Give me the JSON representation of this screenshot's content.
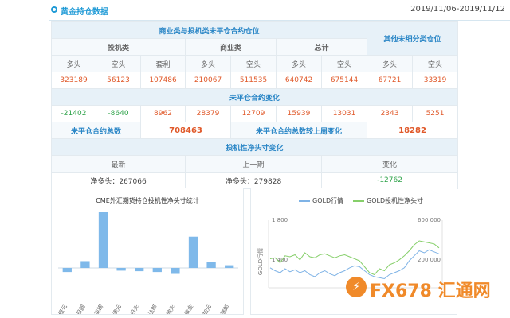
{
  "header": {
    "title": "黄金持仓数据",
    "date_range": "2019/11/06-2019/11/12"
  },
  "table": {
    "sec1_title": "商业类与投机类未平仓合约仓位",
    "sec1_other": "其他未细分类仓位",
    "groups": [
      "投机类",
      "商业类",
      "总计"
    ],
    "cols": [
      "多头",
      "空头",
      "套利",
      "多头",
      "空头",
      "多头",
      "空头",
      "多头",
      "空头"
    ],
    "values": [
      "323189",
      "56123",
      "107486",
      "210067",
      "511535",
      "640742",
      "675144",
      "67721",
      "33319"
    ],
    "sec2_title": "未平仓合约变化",
    "changes": [
      "-21402",
      "-8640",
      "8962",
      "28379",
      "12709",
      "15939",
      "13031",
      "2343",
      "5251"
    ],
    "total_label": "未平仓合约总数",
    "total_value": "708463",
    "week_change_label": "未平仓合约总数较上周变化",
    "week_change_value": "18282",
    "sec3_title": "投机性净头寸变化",
    "latest_label": "最新",
    "prev_label": "上一期",
    "change_label": "变化",
    "latest_value": "净多头：267066",
    "prev_value": "净多头：279828",
    "change_value": "-12762"
  },
  "bar_chart_title": "CME外汇期货持仓投机性净头寸统计",
  "line_chart": {
    "legend": [
      "GOLD行情",
      "GOLD投机性净头寸"
    ],
    "left_ticks": [
      "1 800",
      "1 400"
    ],
    "right_ticks": [
      "600 000",
      "200 000"
    ],
    "ylabel": "GOLD行情",
    "colors": {
      "price": "#7fb3e6",
      "position": "#86cf6a"
    }
  },
  "watermark": {
    "badge": "⚡",
    "text": "FX678 汇通网"
  },
  "chart_data": [
    {
      "type": "bar",
      "title": "CME外汇期货持仓投机性净头寸统计",
      "categories": [
        "纽元",
        "日圆",
        "英镑",
        "澳元",
        "日元",
        "瑞士法郎",
        "欧元",
        "黄金",
        "加元",
        "瑞郎"
      ],
      "values": [
        -15000,
        25000,
        205000,
        -10000,
        -12000,
        -15000,
        -22000,
        115000,
        23000,
        10000
      ],
      "color": "#7fb9ea"
    },
    {
      "type": "line",
      "series": [
        {
          "name": "GOLD行情",
          "values": [
            1330,
            1300,
            1280,
            1320,
            1290,
            1310,
            1280,
            1300,
            1260,
            1240,
            1280,
            1300,
            1270,
            1250,
            1280,
            1300,
            1330,
            1350,
            1340,
            1300,
            1260,
            1240,
            1230,
            1220,
            1260,
            1280,
            1300,
            1330,
            1400,
            1450,
            1500,
            1480,
            1510,
            1490,
            1470
          ]
        },
        {
          "name": "GOLD投机性净头寸",
          "values": [
            220000,
            230000,
            180000,
            250000,
            240000,
            260000,
            210000,
            280000,
            240000,
            230000,
            260000,
            270000,
            250000,
            230000,
            250000,
            260000,
            240000,
            220000,
            200000,
            140000,
            80000,
            60000,
            120000,
            100000,
            160000,
            180000,
            210000,
            250000,
            300000,
            360000,
            400000,
            390000,
            380000,
            370000,
            330000
          ]
        }
      ]
    }
  ]
}
